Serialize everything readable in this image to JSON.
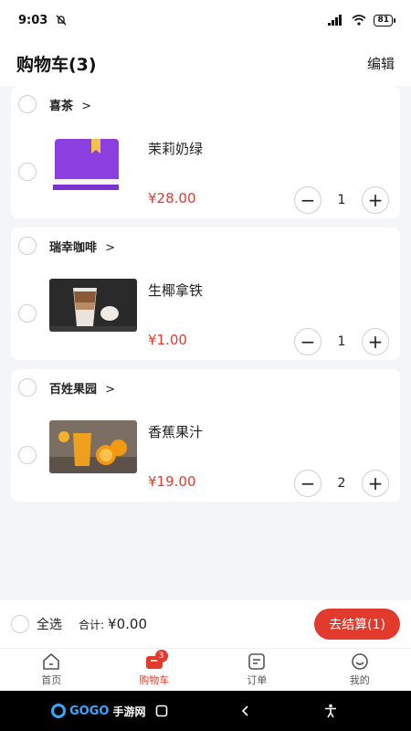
{
  "status": {
    "time": "9:03",
    "battery": "81",
    "hd": "HD"
  },
  "header": {
    "title": "购物车(3)",
    "edit": "编辑"
  },
  "shops": [
    {
      "name": "喜茶",
      "chevron": ">",
      "item": {
        "name": "茉莉奶绿",
        "price": "¥28.00",
        "qty": "1"
      }
    },
    {
      "name": "瑞幸咖啡",
      "chevron": ">",
      "item": {
        "name": "生椰拿铁",
        "price": "¥1.00",
        "qty": "1"
      }
    },
    {
      "name": "百姓果园",
      "chevron": ">",
      "item": {
        "name": "香蕉果汁",
        "price": "¥19.00",
        "qty": "2"
      }
    }
  ],
  "stepper": {
    "minus": "−",
    "plus": "+"
  },
  "checkout": {
    "select_all": "全选",
    "total_label": "合计:",
    "total_amount": "¥0.00",
    "button": "去结算(1)"
  },
  "tabs": [
    {
      "label": "首页",
      "icon": "home-icon"
    },
    {
      "label": "购物车",
      "icon": "cart-icon",
      "badge": "3"
    },
    {
      "label": "订单",
      "icon": "order-icon"
    },
    {
      "label": "我的",
      "icon": "profile-icon"
    }
  ],
  "navbar": {
    "logo_text": "GOGO",
    "logo_sub": "手游网"
  },
  "colors": {
    "accent": "#e23b2e",
    "background": "#f4f5f7"
  }
}
